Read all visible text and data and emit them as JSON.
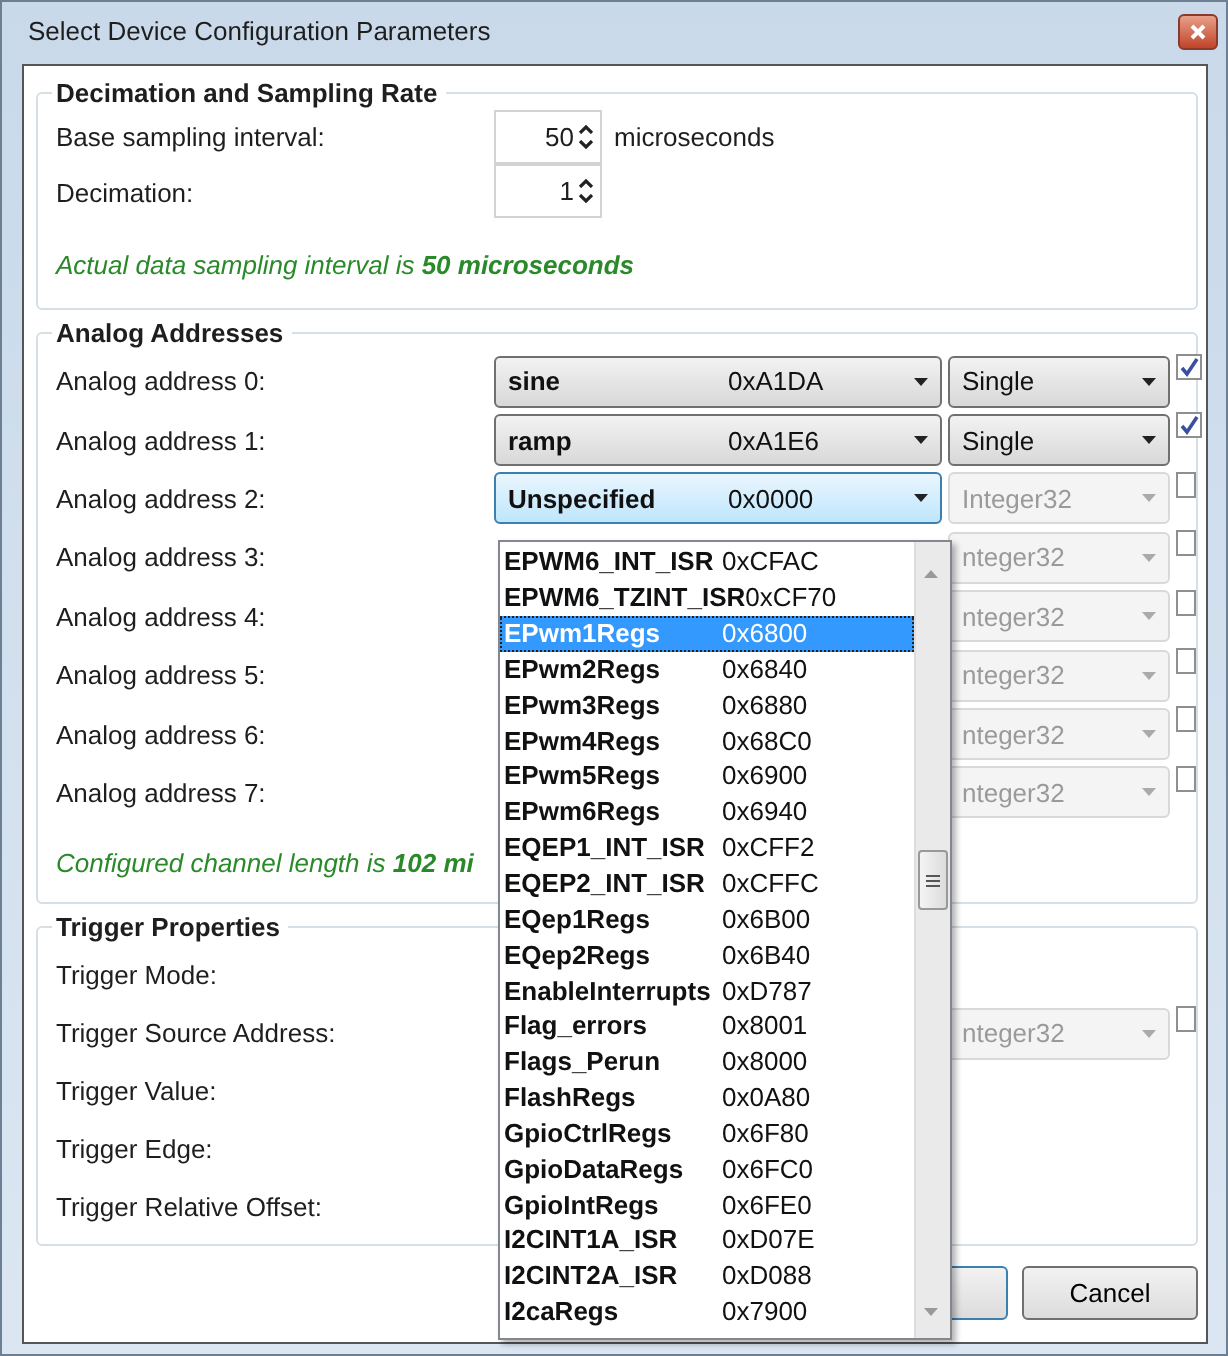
{
  "window": {
    "title": "Select Device Configuration Parameters"
  },
  "sampling": {
    "title": "Decimation and Sampling Rate",
    "fields": [
      {
        "label": "Base sampling interval:",
        "value": "50",
        "unit": "microseconds"
      },
      {
        "label": "Decimation:",
        "value": "1"
      }
    ],
    "note": "Actual data sampling interval is  **50  microseconds**"
  },
  "analog": {
    "title": "Analog Addresses",
    "rows": [
      {
        "label": "Analog address 0:",
        "address": {
          "name": "sine",
          "value": "0xA1DA",
          "focused": false
        },
        "type": {
          "value": "Single",
          "disabled": false
        },
        "checked": true
      },
      {
        "label": "Analog address 1:",
        "address": {
          "name": "ramp",
          "value": "0xA1E6",
          "focused": false
        },
        "type": {
          "value": "Single",
          "disabled": false
        },
        "checked": true
      },
      {
        "label": "Analog address 2:",
        "address": {
          "name": "Unspecified",
          "value": "0x0000",
          "focused": true
        },
        "type": {
          "value": "Integer32",
          "disabled": true
        },
        "checked": false
      },
      {
        "label": "Analog address 3:",
        "type": {
          "value": "nteger32",
          "disabled": true
        },
        "checked": false
      },
      {
        "label": "Analog address 4:",
        "type": {
          "value": "nteger32",
          "disabled": true
        },
        "checked": false
      },
      {
        "label": "Analog address 5:",
        "type": {
          "value": "nteger32",
          "disabled": true
        },
        "checked": false
      },
      {
        "label": "Analog address 6:",
        "type": {
          "value": "nteger32",
          "disabled": true
        },
        "checked": false
      },
      {
        "label": "Analog address 7:",
        "type": {
          "value": "nteger32",
          "disabled": true
        },
        "checked": false
      }
    ],
    "note": "Configured channel length is  **102 mi**"
  },
  "trigger": {
    "title": "Trigger Properties",
    "rows": [
      {
        "label": "Trigger Mode:"
      },
      {
        "label": "Trigger Source Address:",
        "type": {
          "value": "nteger32",
          "disabled": true
        },
        "checked": false
      },
      {
        "label": "Trigger Value:"
      },
      {
        "label": "Trigger Edge:"
      },
      {
        "label": "Trigger Relative Offset:"
      }
    ]
  },
  "dropdown": {
    "items": [
      {
        "name": "EPWM6_INT_ISR",
        "value": "0xCFAC",
        "selected": false
      },
      {
        "name": "EPWM6_TZINT_ISR",
        "value": "0xCF70",
        "selected": false
      },
      {
        "name": "EPwm1Regs",
        "value": "0x6800",
        "selected": true
      },
      {
        "name": "EPwm2Regs",
        "value": "0x6840",
        "selected": false
      },
      {
        "name": "EPwm3Regs",
        "value": "0x6880",
        "selected": false
      },
      {
        "name": "EPwm4Regs",
        "value": "0x68C0",
        "selected": false
      },
      {
        "name": "EPwm5Regs",
        "value": "0x6900",
        "selected": false
      },
      {
        "name": "EPwm6Regs",
        "value": "0x6940",
        "selected": false
      },
      {
        "name": "EQEP1_INT_ISR",
        "value": "0xCFF2",
        "selected": false
      },
      {
        "name": "EQEP2_INT_ISR",
        "value": "0xCFFC",
        "selected": false
      },
      {
        "name": "EQep1Regs",
        "value": "0x6B00",
        "selected": false
      },
      {
        "name": "EQep2Regs",
        "value": "0x6B40",
        "selected": false
      },
      {
        "name": "EnableInterrupts",
        "value": "0xD787",
        "selected": false
      },
      {
        "name": "Flag_errors",
        "value": "0x8001",
        "selected": false
      },
      {
        "name": "Flags_Perun",
        "value": "0x8000",
        "selected": false
      },
      {
        "name": "FlashRegs",
        "value": "0x0A80",
        "selected": false
      },
      {
        "name": "GpioCtrlRegs",
        "value": "0x6F80",
        "selected": false
      },
      {
        "name": "GpioDataRegs",
        "value": "0x6FC0",
        "selected": false
      },
      {
        "name": "GpioIntRegs",
        "value": "0x6FE0",
        "selected": false
      },
      {
        "name": "I2CINT1A_ISR",
        "value": "0xD07E",
        "selected": false
      },
      {
        "name": "I2CINT2A_ISR",
        "value": "0xD088",
        "selected": false
      },
      {
        "name": "I2caRegs",
        "value": "0x7900",
        "selected": false
      }
    ]
  },
  "buttons": [
    {
      "kind": "default"
    },
    {
      "kind": "normal",
      "label": "Cancel"
    }
  ]
}
